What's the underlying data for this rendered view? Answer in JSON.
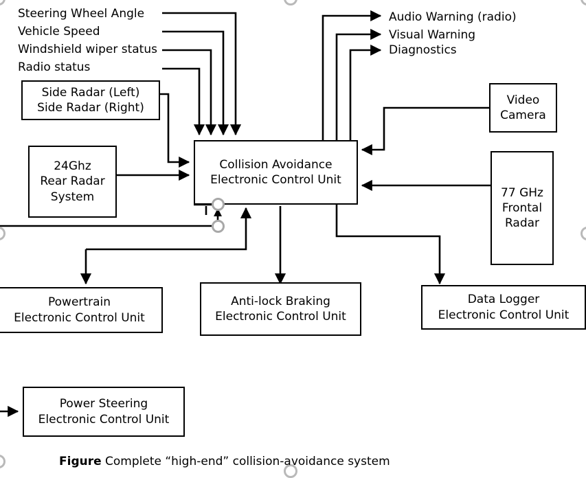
{
  "figure": {
    "caption_bold": "Figure",
    "caption_rest": "Complete “high-end” collision-avoidance system"
  },
  "inputs": {
    "signals": [
      {
        "label": "Steering Wheel Angle"
      },
      {
        "label": "Vehicle Speed"
      },
      {
        "label": "Windshield wiper status"
      },
      {
        "label": "Radio status"
      }
    ]
  },
  "outputs": {
    "signals": [
      {
        "label": "Audio Warning (radio)"
      },
      {
        "label": "Visual Warning"
      },
      {
        "label": "Diagnostics"
      }
    ]
  },
  "nodes": {
    "side_radar": {
      "name": "side-radar",
      "lines": [
        "Side Radar (Left)",
        "Side Radar (Right)"
      ]
    },
    "rear_radar": {
      "name": "rear-radar",
      "lines": [
        "24Ghz",
        "Rear Radar",
        "System"
      ]
    },
    "ecu": {
      "name": "collision-avoidance-ecu",
      "lines": [
        "Collision Avoidance",
        "Electronic Control Unit"
      ]
    },
    "video_camera": {
      "name": "video-camera",
      "lines": [
        "Video",
        "Camera"
      ]
    },
    "frontal_radar": {
      "name": "frontal-radar",
      "lines": [
        "77 GHz",
        "Frontal",
        "Radar"
      ]
    },
    "powertrain_ecu": {
      "name": "powertrain-ecu",
      "lines": [
        "Powertrain",
        "Electronic Control Unit"
      ]
    },
    "abs_ecu": {
      "name": "anti-lock-braking-ecu",
      "lines": [
        "Anti-lock Braking",
        "Electronic Control Unit"
      ]
    },
    "data_logger_ecu": {
      "name": "data-logger-ecu",
      "lines": [
        "Data Logger",
        "Electronic Control Unit"
      ]
    },
    "power_steering_ecu": {
      "name": "power-steering-ecu",
      "lines": [
        "Power Steering",
        "Electronic Control Unit"
      ]
    }
  },
  "colors": {
    "stroke": "#000000",
    "background": "#ffffff",
    "terminal_ring": "#a8a8a8"
  },
  "chart_data": {
    "type": "diagram",
    "title": "Complete “high-end” collision-avoidance system",
    "blocks": [
      "Side Radar (Left) / Side Radar (Right)",
      "24Ghz Rear Radar System",
      "Collision Avoidance Electronic Control Unit",
      "Video Camera",
      "77 GHz Frontal Radar",
      "Powertrain Electronic Control Unit",
      "Anti-lock Braking Electronic Control Unit",
      "Data Logger Electronic Control Unit",
      "Power Steering Electronic Control Unit"
    ],
    "inputs_to_ecu": [
      "Steering Wheel Angle",
      "Vehicle Speed",
      "Windshield wiper status",
      "Radio status",
      "Side Radar (Left) / Side Radar (Right)",
      "24Ghz Rear Radar System",
      "Video Camera",
      "77 GHz Frontal Radar"
    ],
    "outputs_from_ecu": [
      "Audio Warning (radio)",
      "Visual Warning",
      "Diagnostics",
      "Powertrain Electronic Control Unit",
      "Anti-lock Braking Electronic Control Unit",
      "Data Logger Electronic Control Unit",
      "Power Steering Electronic Control Unit"
    ]
  }
}
